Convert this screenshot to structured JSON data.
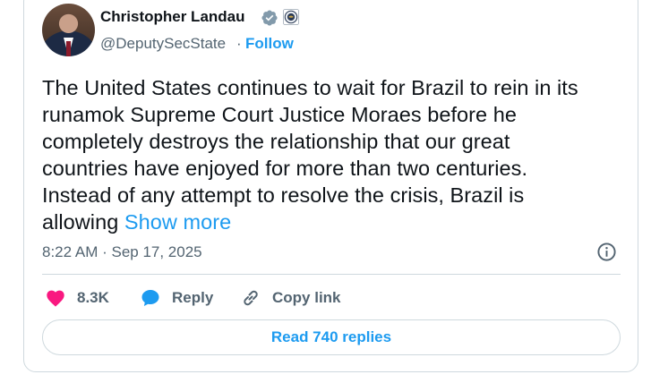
{
  "author": {
    "name": "Christopher Landau",
    "handle": "@DeputySecState",
    "separator": "·",
    "follow_label": "Follow",
    "badge_icon": "verified-gray-icon",
    "affiliate_icon": "state-department-seal-icon"
  },
  "tweet": {
    "lines": [
      "The United States continues to wait for Brazil to rein in its",
      "runamok Supreme Court Justice Moraes before he",
      "completely destroys the relationship that our great",
      "countries have enjoyed for more than two centuries.",
      "Instead of any attempt to resolve the crisis, Brazil is",
      "allowing"
    ],
    "show_more": "Show more",
    "timestamp": "8:22 AM · Sep 17, 2025"
  },
  "actions": {
    "likes": "8.3K",
    "reply": "Reply",
    "copy_link": "Copy link"
  },
  "replies_button": "Read 740 replies",
  "colors": {
    "accent": "#1d9bf0",
    "like": "#f91880",
    "muted": "#536471",
    "border": "#cfd9de"
  }
}
